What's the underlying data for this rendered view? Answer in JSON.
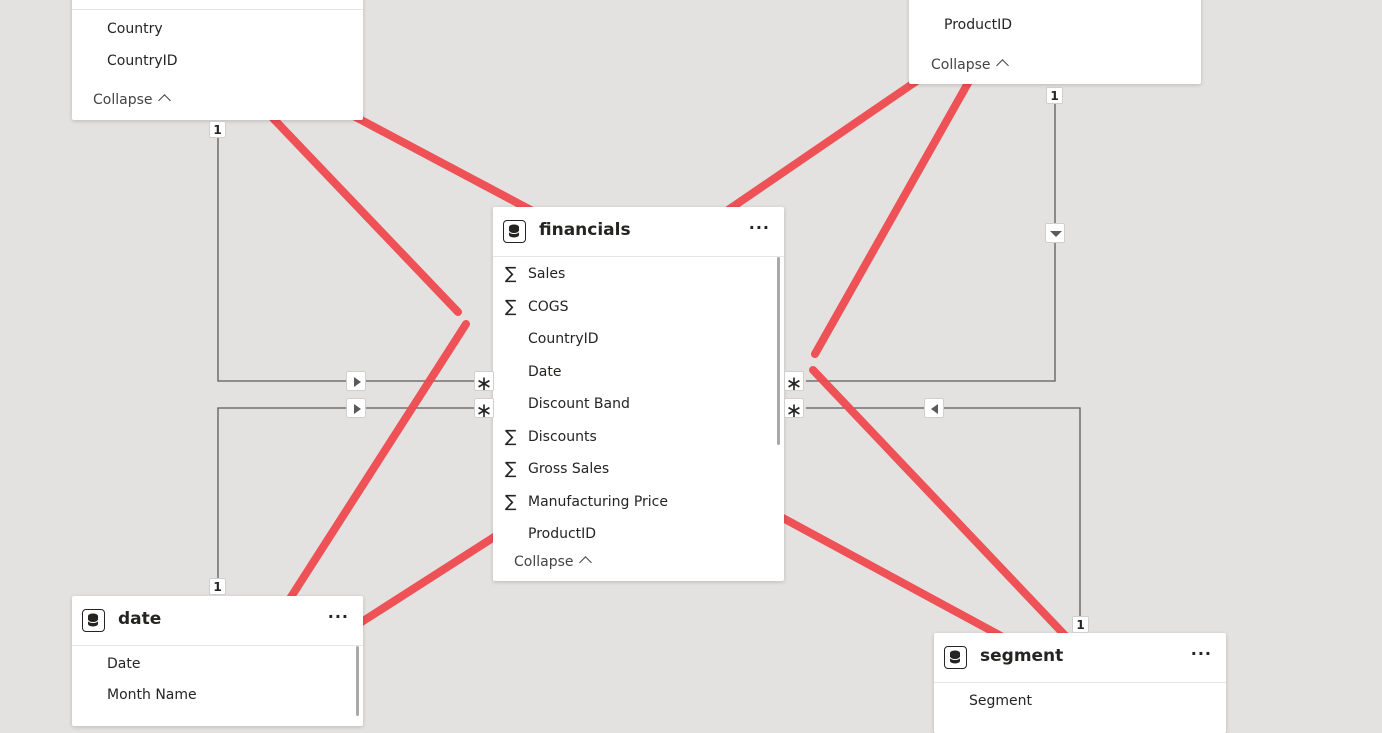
{
  "colors": {
    "canvas_bg": "#e4e2e1",
    "card_bg": "#ffffff",
    "relationship_line": "#5a5a5a",
    "annotation_red": "#ef4a4f"
  },
  "icons": {
    "table": "database-icon",
    "measure": "sigma-icon",
    "more": "ellipsis-icon",
    "collapse": "chevron-up-icon",
    "filter_direction": "triangle-arrow-icon"
  },
  "tables": {
    "top_left": {
      "fields": [
        "Country",
        "CountryID"
      ],
      "collapse_label": "Collapse"
    },
    "top_right": {
      "fields": [
        "ProductID"
      ],
      "collapse_label": "Collapse"
    },
    "financials": {
      "title": "financials",
      "more_label": "···",
      "fields": [
        {
          "label": "Sales",
          "measure": true
        },
        {
          "label": "COGS",
          "measure": true
        },
        {
          "label": "CountryID",
          "measure": false
        },
        {
          "label": "Date",
          "measure": false
        },
        {
          "label": "Discount Band",
          "measure": false
        },
        {
          "label": "Discounts",
          "measure": true
        },
        {
          "label": "Gross Sales",
          "measure": true
        },
        {
          "label": "Manufacturing Price",
          "measure": true
        },
        {
          "label": "ProductID",
          "measure": false
        }
      ],
      "collapse_label": "Collapse"
    },
    "date": {
      "title": "date",
      "more_label": "···",
      "fields": [
        "Date",
        "Month Name"
      ]
    },
    "segment": {
      "title": "segment",
      "more_label": "···",
      "fields": [
        "Segment"
      ]
    }
  },
  "relationships": {
    "one_label": "1",
    "many_label": "∗",
    "sigma_symbol": "∑"
  }
}
